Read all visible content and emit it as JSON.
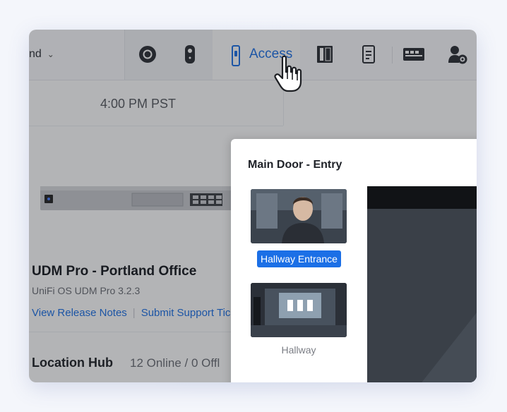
{
  "topbar": {
    "site_select": "nd",
    "nav": [
      {
        "name": "protect",
        "icon": "protect-camera-icon"
      },
      {
        "name": "doorbell",
        "icon": "doorbell-icon"
      },
      {
        "name": "access",
        "label": "Access",
        "icon": "access-reader-icon"
      },
      {
        "name": "door-hub",
        "icon": "door-hub-icon"
      },
      {
        "name": "intercom",
        "icon": "intercom-icon"
      },
      {
        "name": "network-switch",
        "icon": "switch-icon"
      },
      {
        "name": "users-settings",
        "icon": "user-gear-icon"
      }
    ]
  },
  "main": {
    "time": "4:00 PM PST",
    "device": {
      "title": "UDM Pro - Portland Office",
      "subtitle": "UniFi OS UDM Pro 3.2.3",
      "link_release_notes": "View Release Notes",
      "link_support": "Submit Support Tick"
    },
    "hub": {
      "title": "Location Hub",
      "status": "12 Online / 0 Offl"
    }
  },
  "popup": {
    "title": "Main Door - Entry",
    "cameras": [
      {
        "label": "Hallway Entrance",
        "selected": true
      },
      {
        "label": "Hallway",
        "selected": false
      }
    ]
  },
  "colors": {
    "accent": "#1b6fe6",
    "overlay": "rgba(32,34,40,0.34)"
  }
}
